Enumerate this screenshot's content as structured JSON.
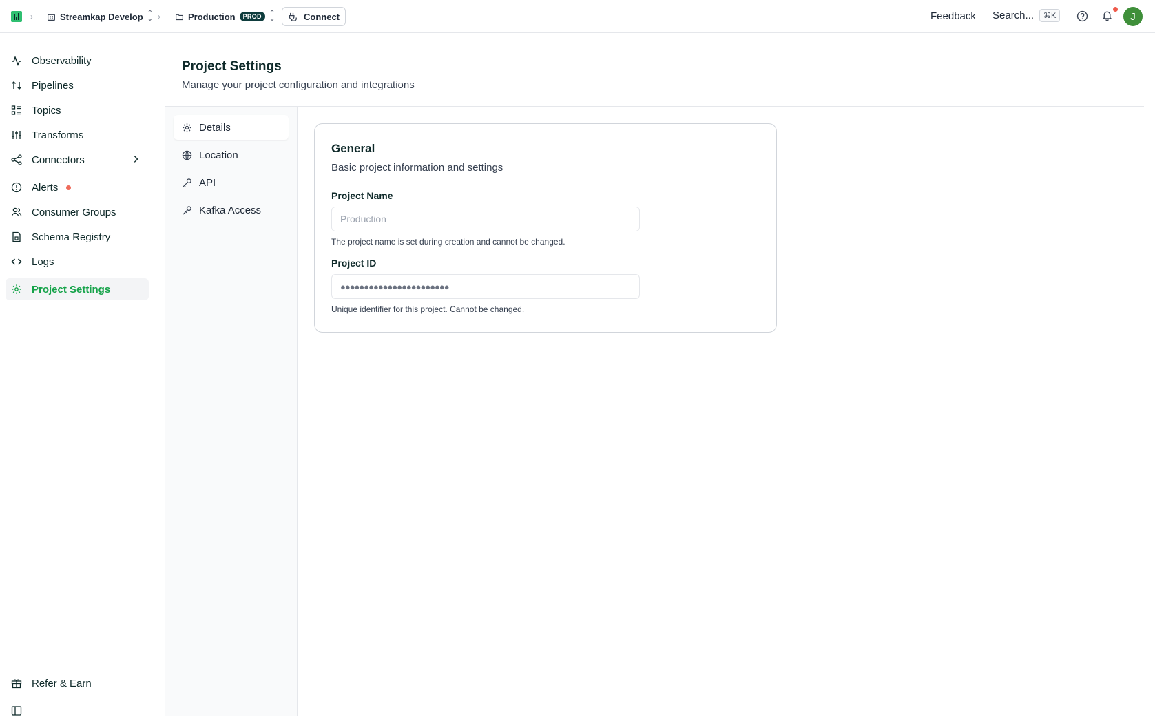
{
  "topbar": {
    "workspace": "Streamkap Develop",
    "project": "Production",
    "project_badge": "PROD",
    "connect_label": "Connect",
    "feedback_label": "Feedback",
    "search_label": "Search...",
    "search_shortcut": "⌘K",
    "avatar_initial": "J"
  },
  "sidebar": {
    "items": [
      {
        "label": "Observability",
        "icon": "activity-icon"
      },
      {
        "label": "Pipelines",
        "icon": "arrows-up-down-icon"
      },
      {
        "label": "Topics",
        "icon": "list-icon"
      },
      {
        "label": "Transforms",
        "icon": "sliders-icon"
      },
      {
        "label": "Connectors",
        "icon": "share-nodes-icon"
      },
      {
        "label": "Alerts",
        "icon": "alert-circle-icon"
      },
      {
        "label": "Consumer Groups",
        "icon": "users-icon"
      },
      {
        "label": "Schema Registry",
        "icon": "file-schema-icon"
      },
      {
        "label": "Logs",
        "icon": "code-icon"
      },
      {
        "label": "Project Settings",
        "icon": "gear-icon"
      }
    ],
    "refer_label": "Refer & Earn"
  },
  "page": {
    "title": "Project Settings",
    "subtitle": "Manage your project configuration and integrations"
  },
  "subnav": {
    "items": [
      {
        "label": "Details",
        "icon": "gear-icon"
      },
      {
        "label": "Location",
        "icon": "globe-icon"
      },
      {
        "label": "API",
        "icon": "key-icon"
      },
      {
        "label": "Kafka Access",
        "icon": "key-icon"
      }
    ]
  },
  "card": {
    "title": "General",
    "subtitle": "Basic project information and settings",
    "name_label": "Project Name",
    "name_placeholder": "Production",
    "name_help": "The project name is set during creation and cannot be changed.",
    "id_label": "Project ID",
    "id_value": "●●●●●●●●●●●●●●●●●●●●●●●",
    "id_help": "Unique identifier for this project. Cannot be changed."
  },
  "colors": {
    "accent": "#16a34a",
    "badge": "#0f3d3e",
    "alert": "#ef6b5b",
    "avatar": "#3f8f3a"
  }
}
